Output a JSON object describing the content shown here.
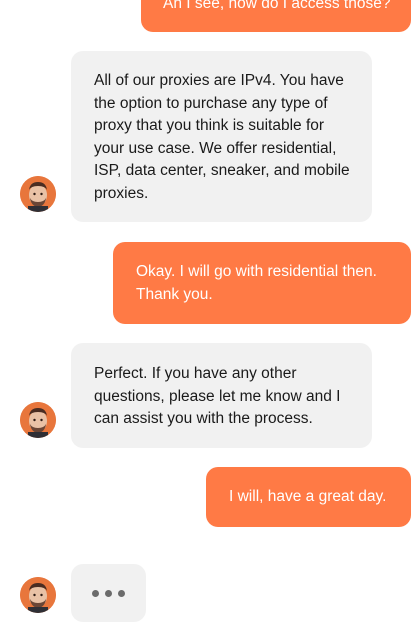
{
  "messages": [
    {
      "from": "user",
      "text": "Ah I see, how do I access those?"
    },
    {
      "from": "agent",
      "text": "All of our proxies are IPv4. You have the option to purchase any type of proxy that you think is suitable for your use case. We offer residential, ISP, data center, sneaker, and mobile proxies."
    },
    {
      "from": "user",
      "text": "Okay. I will go with residential then. Thank you."
    },
    {
      "from": "agent",
      "text": "Perfect. If you have any other questions, please let me know and I can assist you with the process."
    },
    {
      "from": "user",
      "text": "I will, have a great day."
    }
  ],
  "colors": {
    "user_bubble": "#ff7a45",
    "agent_bubble": "#f1f1f1",
    "avatar_bg": "#e8763c"
  },
  "icons": {
    "avatar": "agent-avatar",
    "typing": "typing-indicator-icon"
  }
}
